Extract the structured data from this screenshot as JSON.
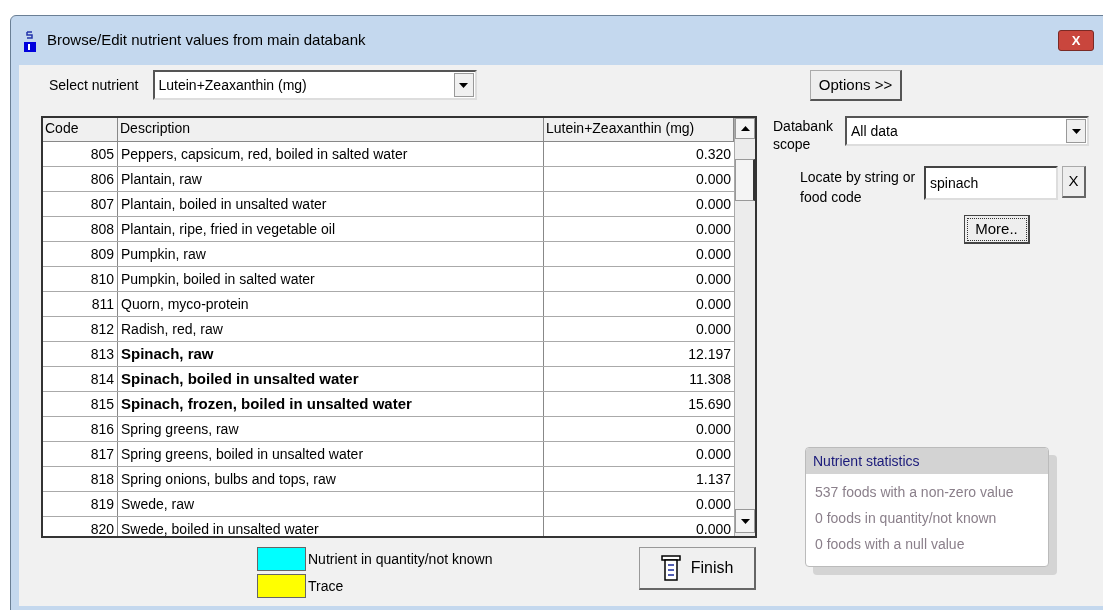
{
  "window": {
    "title": "Browse/Edit nutrient values from main databank",
    "close_label": "X"
  },
  "nutrient_select": {
    "label": "Select nutrient",
    "value": "Lutein+Zeaxanthin (mg)"
  },
  "options_button": "Options >>",
  "table": {
    "columns": [
      "Code",
      "Description",
      "Lutein+Zeaxanthin (mg)"
    ],
    "rows": [
      {
        "code": "805",
        "description": "Peppers, capsicum, red, boiled in salted water",
        "value": "0.320",
        "match": false
      },
      {
        "code": "806",
        "description": "Plantain, raw",
        "value": "0.000",
        "match": false
      },
      {
        "code": "807",
        "description": "Plantain, boiled in unsalted water",
        "value": "0.000",
        "match": false
      },
      {
        "code": "808",
        "description": "Plantain, ripe, fried in vegetable oil",
        "value": "0.000",
        "match": false
      },
      {
        "code": "809",
        "description": "Pumpkin, raw",
        "value": "0.000",
        "match": false
      },
      {
        "code": "810",
        "description": "Pumpkin, boiled in salted water",
        "value": "0.000",
        "match": false
      },
      {
        "code": "811",
        "description": "Quorn, myco-protein",
        "value": "0.000",
        "match": false
      },
      {
        "code": "812",
        "description": "Radish, red, raw",
        "value": "0.000",
        "match": false
      },
      {
        "code": "813",
        "description": "Spinach, raw",
        "value": "12.197",
        "match": true
      },
      {
        "code": "814",
        "description": "Spinach, boiled in unsalted water",
        "value": "11.308",
        "match": true
      },
      {
        "code": "815",
        "description": "Spinach, frozen, boiled in unsalted water",
        "value": "15.690",
        "match": true
      },
      {
        "code": "816",
        "description": "Spring greens, raw",
        "value": "0.000",
        "match": false
      },
      {
        "code": "817",
        "description": "Spring greens, boiled in unsalted water",
        "value": "0.000",
        "match": false
      },
      {
        "code": "818",
        "description": "Spring onions, bulbs and tops, raw",
        "value": "1.137",
        "match": false
      },
      {
        "code": "819",
        "description": "Swede, raw",
        "value": "0.000",
        "match": false
      },
      {
        "code": "820",
        "description": "Swede, boiled in unsalted water",
        "value": "0.000",
        "match": false
      }
    ]
  },
  "databank_scope": {
    "label": "Databank scope",
    "value": "All data"
  },
  "locate": {
    "label": "Locate by string or food code",
    "value": "spinach",
    "clear_label": "X",
    "more_button": "More.."
  },
  "legend": [
    {
      "label": "Nutrient in quantity/not known",
      "color": "#00ffff"
    },
    {
      "label": "Trace",
      "color": "#ffff00"
    }
  ],
  "finish_button": "Finish",
  "statistics": {
    "title": "Nutrient statistics",
    "lines": [
      "537 foods with a non-zero value",
      "0 foods in quantity/not known",
      "0 foods with a null value"
    ]
  }
}
